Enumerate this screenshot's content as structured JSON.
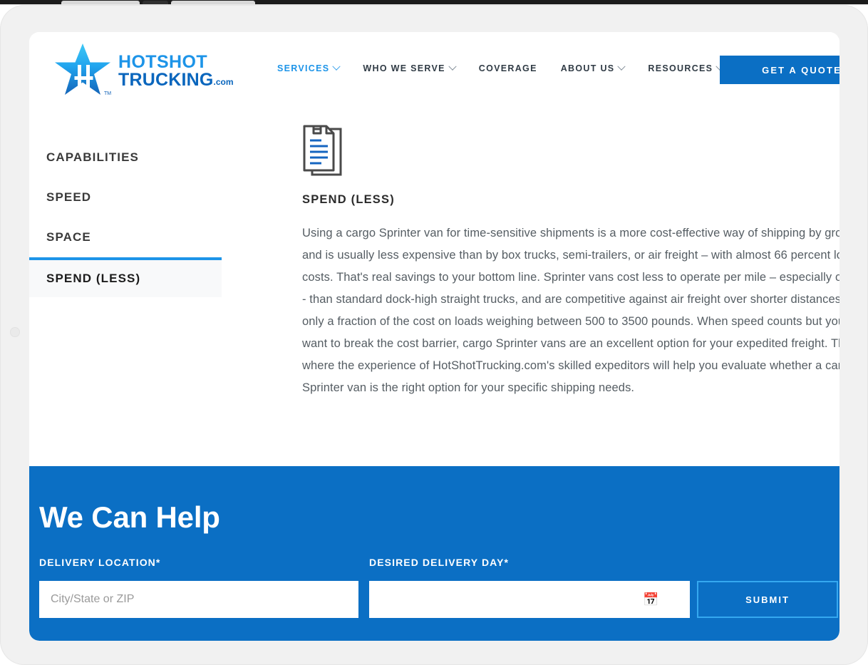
{
  "header": {
    "logo": {
      "icon": "star-logo-icon",
      "line1": "HOTSHOT",
      "line2": "TRUCKING",
      "suffix": ".com",
      "trademark": "TM"
    },
    "nav": [
      {
        "label": "SERVICES",
        "has_chevron": true,
        "active": true
      },
      {
        "label": "WHO WE SERVE",
        "has_chevron": true,
        "active": false
      },
      {
        "label": "COVERAGE",
        "has_chevron": false,
        "active": false
      },
      {
        "label": "ABOUT US",
        "has_chevron": true,
        "active": false
      },
      {
        "label": "RESOURCES",
        "has_chevron": true,
        "active": false
      }
    ],
    "quote_button": "GET A QUOTE"
  },
  "sidebar": {
    "items": [
      {
        "label": "CAPABILITIES",
        "active": false
      },
      {
        "label": "SPEED",
        "active": false
      },
      {
        "label": "SPACE",
        "active": false
      },
      {
        "label": "SPEND (LESS)",
        "active": true
      }
    ]
  },
  "panel": {
    "icon": "document-invoice-icon",
    "title": "SPEND (LESS)",
    "body": "Using a cargo Sprinter van for time-sensitive shipments is a more cost-effective way of shipping by ground, and is usually less expensive than by box trucks, semi-trailers, or air freight – with almost 66 percent lower costs. That's real savings to your bottom line. Sprinter vans cost less to operate per mile – especially on fuel - than standard dock-high straight trucks, and are competitive against air freight over shorter distances at only a fraction of the cost on loads weighing between 500 to 3500 pounds. When speed counts but you don't want to break the cost barrier, cargo Sprinter vans are an excellent option for your expedited freight. This is where the experience of HotShotTrucking.com's skilled expeditors will help you evaluate whether a cargo Sprinter van is the right option for your specific shipping needs."
  },
  "form": {
    "title": "We Can Help",
    "location_label": "DELIVERY LOCATION*",
    "location_placeholder": "City/State or ZIP",
    "location_value": "",
    "day_label": "DESIRED DELIVERY DAY*",
    "day_placeholder": "",
    "day_value": "",
    "calendar_icon": "calendar-icon",
    "calendar_glyph": "📅",
    "submit_label": "SUBMIT"
  },
  "colors": {
    "brand_blue": "#0b6fc4",
    "accent_light_blue": "#1d94e8",
    "submit_border": "#35a8f0",
    "active_tab_bg": "#f8f9fa",
    "bezel": "#f1f1f1",
    "body_text": "#555d63"
  }
}
